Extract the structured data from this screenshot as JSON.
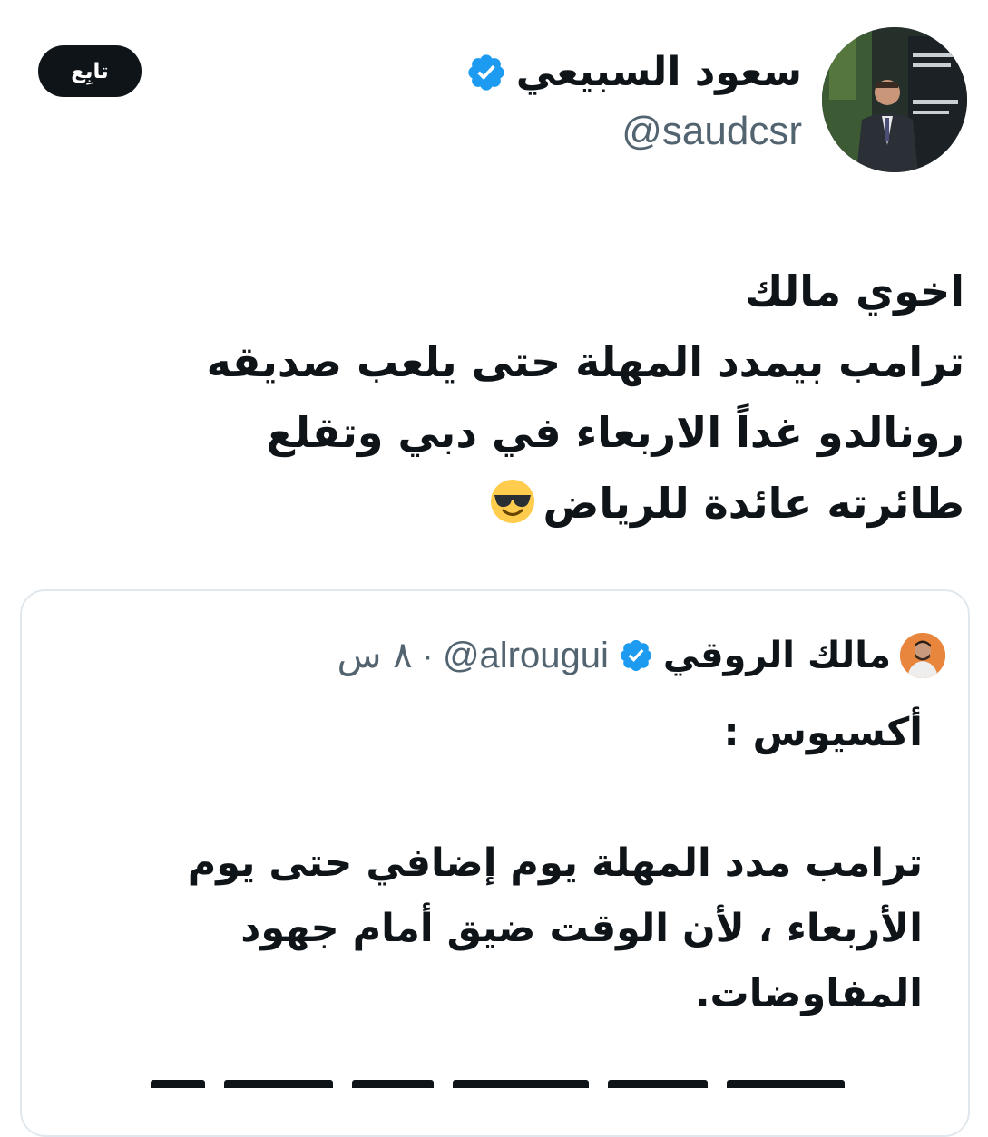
{
  "author": {
    "name": "سعود السبيعي",
    "handle": "@saudcsr",
    "verified": true,
    "avatar_icon": "profile-photo-icon"
  },
  "follow_button": {
    "label": "تابِع"
  },
  "tweet": {
    "lines": [
      "اخوي مالك",
      "ترامب بيمدد المهلة حتى يلعب صديقه",
      "رونالدو غداً الاربعاء في دبي  وتقلع",
      "طائرته عائدة للرياض"
    ],
    "emoji_icon": "smiling-face-with-sunglasses-icon"
  },
  "quoted_tweet": {
    "author_name": "مالك الروقي",
    "handle": "@alrougui",
    "separator": "·",
    "time": "٨ س",
    "verified": true,
    "lines": [
      "أكسيوس :",
      "",
      "ترامب مدد المهلة يوم إضافي حتى يوم",
      "الأربعاء ، لأن الوقت ضيق أمام جهود",
      "المفاوضات."
    ]
  },
  "colors": {
    "text": "#0f1419",
    "secondary_text": "#536471",
    "verified_blue": "#1d9bf0",
    "card_border": "#e1e8ed",
    "follow_button_bg": "#0f1419"
  }
}
